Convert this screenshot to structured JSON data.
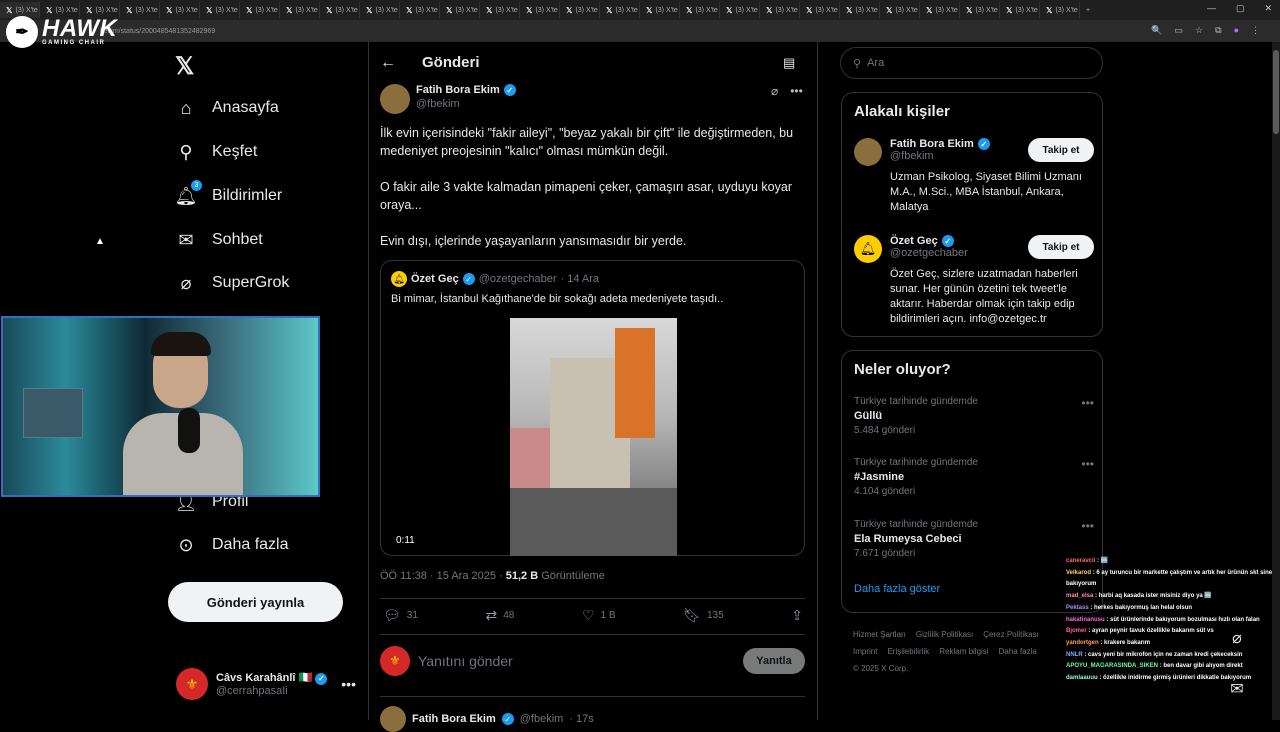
{
  "browser": {
    "tab_label": "(3) X'te",
    "url": "bekim/status/2000485481352482969"
  },
  "overlay_logo": {
    "brand": "HAWK",
    "sub": "GAMING CHAIR"
  },
  "sidebar": {
    "items": [
      {
        "label": "Anasayfa",
        "icon": "home-icon"
      },
      {
        "label": "Keşfet",
        "icon": "search-icon"
      },
      {
        "label": "Bildirimler",
        "icon": "bell-icon",
        "badge": "3"
      },
      {
        "label": "Sohbet",
        "icon": "mail-icon"
      },
      {
        "label": "SuperGrok",
        "icon": "grok-icon"
      },
      {
        "label": "Profil",
        "icon": "person-icon"
      },
      {
        "label": "Daha fazla",
        "icon": "more-circle-icon"
      }
    ],
    "post_button": "Gönderi yayınla",
    "account": {
      "name": "Câvs Karahânlî",
      "handle": "@cerrahpasaIi"
    }
  },
  "header": {
    "title": "Gönderi"
  },
  "post": {
    "author": "Fatih Bora Ekim",
    "handle": "@fbekim",
    "paragraphs": [
      "İlk evin içerisindeki \"fakir aileyi\", \"beyaz yakalı bir çift\" ile değiştirmeden, bu medeniyet preojesinin \"kalıcı\" olması mümkün değil.",
      "O fakir aile 3 vakte kalmadan pimapeni çeker, çamaşırı asar, uyduyu koyar oraya...",
      "Evin dışı, içlerinde yaşayanların yansımasıdır bir yerde."
    ],
    "quote": {
      "author": "Özet Geç",
      "handle": "@ozetgechaber",
      "date": "· 14 Ara",
      "text": "Bi mimar, İstanbul Kağıthane'de bir sokağı adeta medeniyete taşıdı..",
      "duration": "0:11"
    },
    "timestamp": "ÖÖ 11:38 · 15 Ara 2025 ·",
    "views": "51,2 B",
    "views_label": "Görüntüleme",
    "stats": {
      "replies": "31",
      "reposts": "48",
      "likes": "1 B",
      "bookmarks": "135"
    },
    "reply_placeholder": "Yanıtını gönder",
    "reply_button": "Yanıtla",
    "next": {
      "author": "Fatih Bora Ekim",
      "handle": "@fbekim",
      "time": "· 17s"
    }
  },
  "right": {
    "search_placeholder": "Ara",
    "related": {
      "title": "Alakalı kişiler",
      "people": [
        {
          "name": "Fatih Bora Ekim",
          "handle": "@fbekim",
          "bio": "Uzman Psikolog, Siyaset Bilimi Uzmanı M.A., M.Sci., MBA İstanbul, Ankara, Malatya",
          "follow": "Takip et"
        },
        {
          "name": "Özet Geç",
          "handle": "@ozetgechaber",
          "bio": "Özet Geç, sizlere uzatmadan haberleri sunar. Her günün özetini tek tweet'le aktarır. Haberdar olmak için takip edip bildirimleri açın. info@ozetgec.tr",
          "follow": "Takip et"
        }
      ]
    },
    "trends": {
      "title": "Neler oluyor?",
      "items": [
        {
          "context": "Türkiye tarihinde gündemde",
          "topic": "Güllü",
          "count": "5.484 gönderi"
        },
        {
          "context": "Türkiye tarihinde gündemde",
          "topic": "#Jasmine",
          "count": "4.104 gönderi"
        },
        {
          "context": "Türkiye tarihinde gündemde",
          "topic": "Ela Rumeysa Cebeci",
          "count": "7.671 gönderi"
        }
      ],
      "show_more": "Daha fazla göster"
    },
    "footer": [
      "Hizmet Şartları",
      "Gizlilik Politikası",
      "Çerez Politikası",
      "Imprint",
      "Erişilebilirlik",
      "Reklam bilgisi",
      "Daha fazla",
      "© 2025 X Corp."
    ]
  },
  "chat": [
    {
      "user": "caneravcii",
      "msg": ": 🆒",
      "color": "#ff6b6b"
    },
    {
      "user": "Velkarod",
      "msg": ": 6 ay turuncu bir markette çalıştım ve artık her ürünün skt sine bakıyorum",
      "color": "#ffd24a"
    },
    {
      "user": "mad_elsa",
      "msg": ": harbi aq kasada ister misiniz diyo ya 🆒",
      "color": "#ff8fb3"
    },
    {
      "user": "Pektass",
      "msg": ": herkes bakıyormuş lan helal olsun",
      "color": "#b58aff"
    },
    {
      "user": "hakatinanusu",
      "msg": ": süt ürünlerinde bakıyorum bozulması hızlı olan falan",
      "color": "#ff6bd5"
    },
    {
      "user": "Bjomer",
      "msg": ": ayran peynir tavuk özellikle bakarım süt vs",
      "color": "#ff5fa0"
    },
    {
      "user": "yandortgen",
      "msg": ": krakere bakarım",
      "color": "#ff9f5a"
    },
    {
      "user": "NNLR",
      "msg": ": cavs yeni bir mikrofon için ne zaman kredi çekeceksin",
      "color": "#7ab0ff"
    },
    {
      "user": "APOYU_MAGARASINDA_SIKEN",
      "msg": ": ben davar gibi alıyom direkt",
      "color": "#6bff9e"
    },
    {
      "user": "damlaauuu",
      "msg": ": özellikle inidirme girmiş ürünleri dikkatle bakıyorum",
      "color": "#8affd1"
    }
  ]
}
